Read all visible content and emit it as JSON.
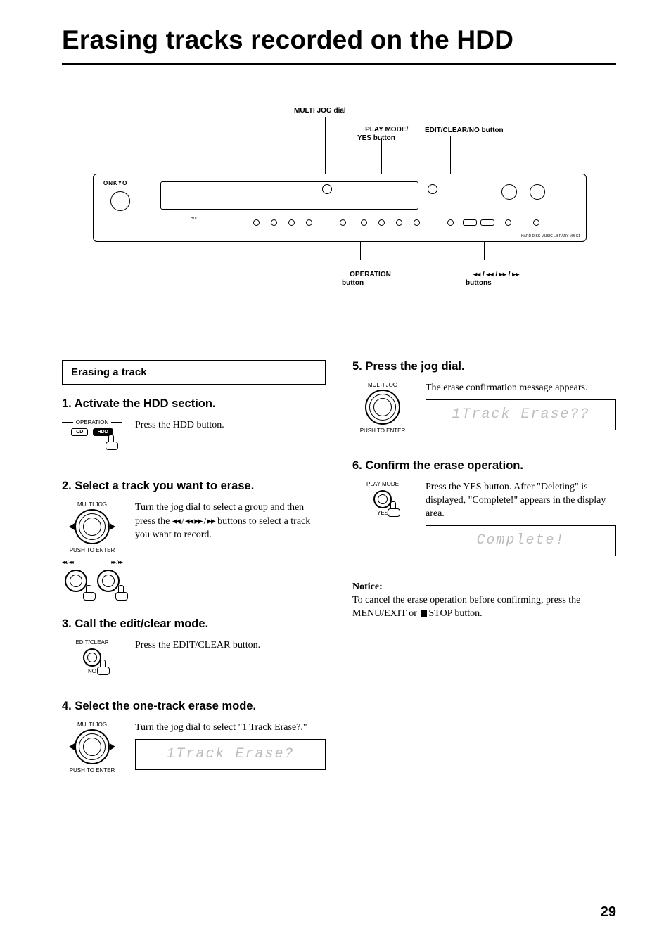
{
  "page_title": "Erasing tracks recorded on the HDD",
  "diagram": {
    "label_multijog": "MULTI JOG dial",
    "label_playmode": "PLAY MODE/\nYES button",
    "label_editclear": "EDIT/CLEAR/NO button",
    "label_operation": "OPERATION\nbutton",
    "label_transport": "◂◂ / ◂◂ / ▸▸ / ▸▸\nbuttons",
    "brand": "ONKYO",
    "model": "HARD DISK MUSIC LIBRARY MB-S1",
    "op_cd": "CD",
    "op_hdd": "HDD"
  },
  "section_heading": "Erasing a track",
  "steps": {
    "s1_h": "1. Activate the HDD section.",
    "s1_icon_top": "OPERATION",
    "s1_icon_cd": "CD",
    "s1_icon_hdd": "HDD",
    "s1_text": "Press the HDD button.",
    "s2_h": "2. Select a track you want to erase.",
    "s2_icon_top": "MULTI JOG",
    "s2_icon_bottom": "PUSH TO ENTER",
    "s2_transport_l": "◂◂ / ◂◂",
    "s2_transport_r": "▸▸ / ▸▸",
    "s2_text_a": "Turn the jog dial to select a group and then press the ",
    "s2_text_b": " buttons to select a track you want to record.",
    "s2_glyphs": "◂◂ / ◂◂  ▸▸ / ▸▸",
    "s3_h": "3. Call the edit/clear mode.",
    "s3_icon_top": "EDIT/CLEAR",
    "s3_icon_bottom": "NO",
    "s3_text": "Press the EDIT/CLEAR button.",
    "s4_h": "4. Select the one-track erase mode.",
    "s4_icon_top": "MULTI JOG",
    "s4_icon_bottom": "PUSH TO ENTER",
    "s4_text": "Turn the jog dial to select \"1 Track Erase?.\"",
    "s4_lcd": "1Track Erase?",
    "s5_h": "5. Press the jog dial.",
    "s5_icon_top": "MULTI JOG",
    "s5_icon_bottom": "PUSH TO ENTER",
    "s5_text": "The erase confirmation message appears.",
    "s5_lcd": "1Track Erase??",
    "s6_h": "6. Confirm the erase operation.",
    "s6_icon_top": "PLAY MODE",
    "s6_icon_bottom": "YES",
    "s6_text": "Press the YES button. After \"Deleting\" is displayed, \"Complete!\" appears in the display area.",
    "s6_lcd": "Complete!",
    "notice_h": "Notice:",
    "notice_a": "To cancel the erase operation before confirming, press the MENU/EXIT or ",
    "notice_stop": "STOP",
    "notice_b": "  button."
  },
  "page_number": "29"
}
